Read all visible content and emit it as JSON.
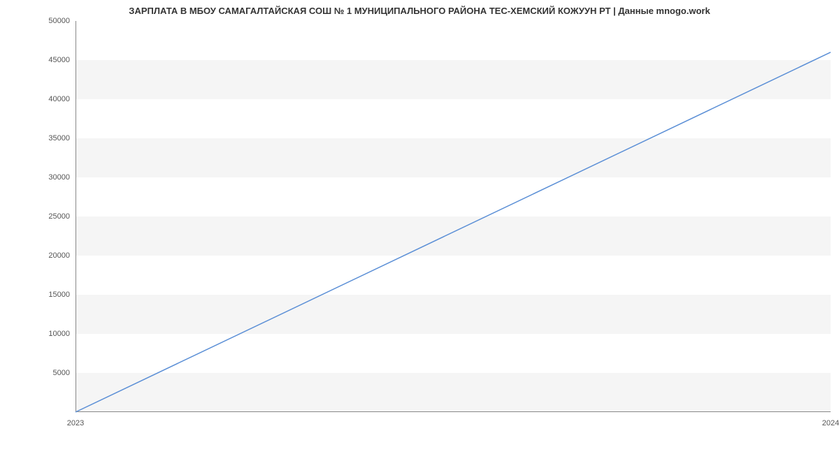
{
  "chart_data": {
    "type": "line",
    "title": "ЗАРПЛАТА В МБОУ САМАГАЛТАЙСКАЯ СОШ № 1 МУНИЦИПАЛЬНОГО РАЙОНА ТЕС-ХЕМСКИЙ КОЖУУН РТ | Данные mnogo.work",
    "x": [
      2023,
      2024
    ],
    "values": [
      0,
      46000
    ],
    "xlabel": "",
    "ylabel": "",
    "xlim": [
      2023,
      2024
    ],
    "ylim": [
      0,
      50000
    ],
    "y_ticks": [
      5000,
      10000,
      15000,
      20000,
      25000,
      30000,
      35000,
      40000,
      45000,
      50000
    ],
    "x_ticks": [
      2023,
      2024
    ],
    "line_color": "#5b8fd6"
  }
}
